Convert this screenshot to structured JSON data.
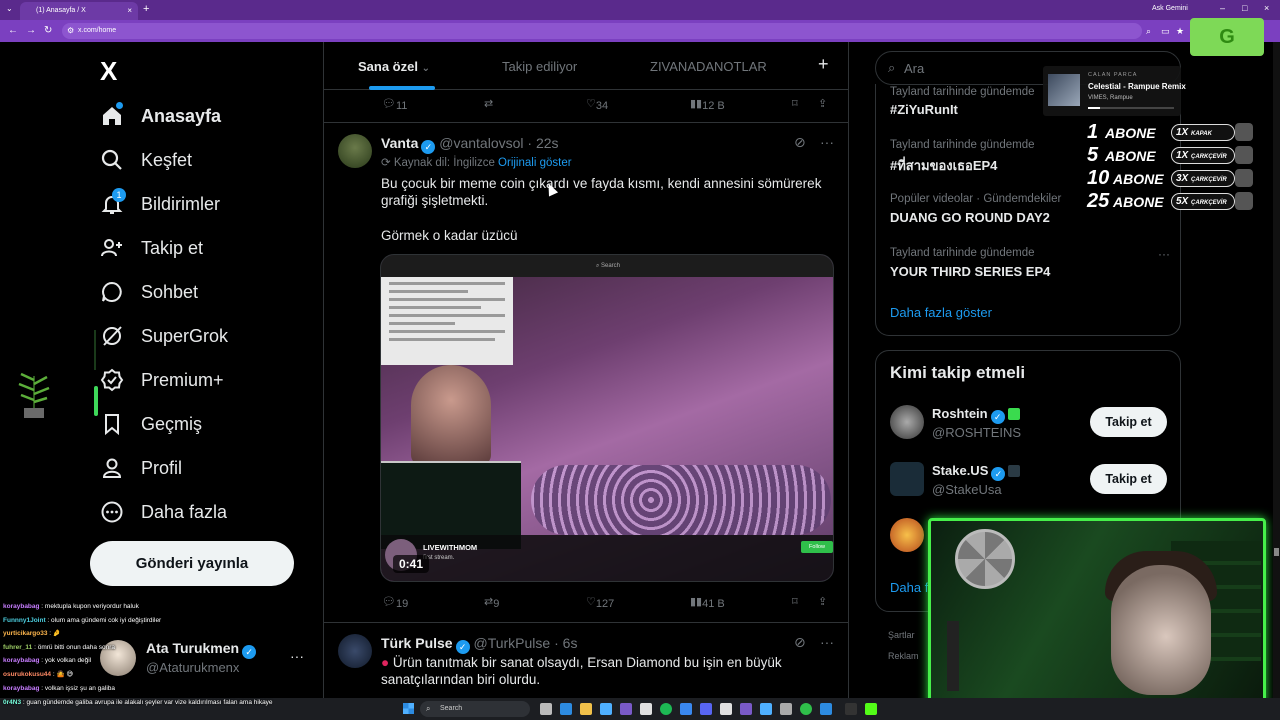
{
  "browser": {
    "tab_title": "(1) Anasayfa / X",
    "tab_close": "×",
    "new_tab": "+",
    "url": "x.com/home",
    "ask_gemini": "Ask Gemini",
    "window_buttons": [
      "–",
      "□",
      "×"
    ]
  },
  "overlay_badge": "G",
  "nav": {
    "logo": "X",
    "items": [
      {
        "label": "Anasayfa",
        "icon": "home-icon",
        "active": true
      },
      {
        "label": "Keşfet",
        "icon": "search-icon"
      },
      {
        "label": "Bildirimler",
        "icon": "bell-icon",
        "badge": "1"
      },
      {
        "label": "Takip et",
        "icon": "person-add-icon"
      },
      {
        "label": "Sohbet",
        "icon": "chat-icon"
      },
      {
        "label": "SuperGrok",
        "icon": "grok-icon"
      },
      {
        "label": "Premium+",
        "icon": "verified-icon"
      },
      {
        "label": "Geçmiş",
        "icon": "bookmark-icon"
      },
      {
        "label": "Profil",
        "icon": "profile-icon"
      },
      {
        "label": "Daha fazla",
        "icon": "more-circle-icon"
      }
    ],
    "post_button": "Gönderi yayınla",
    "account": {
      "name": "Ata Turukmen",
      "handle": "@Ataturukmenx",
      "more": "···"
    }
  },
  "feed": {
    "tabs": [
      "Sana özel",
      "Takip ediliyor",
      "ZIVANADANOTLAR"
    ],
    "active_tab": 0,
    "add_tab": "+",
    "prev_actions": {
      "replies": "11",
      "reposts": "",
      "likes": "34",
      "views": "12 B"
    },
    "tweets": [
      {
        "name": "Vanta",
        "handle": "@vantalovsol",
        "time": "22s",
        "translate_note": "Kaynak dil: İngilizce",
        "show_original": "Orijinali göster",
        "text_1": "Bu çocuk bir meme coin çıkardı ve fayda kısmı, kendi annesini sömürerek",
        "text_2": "grafiği şişletmekti.",
        "text_3": "Görmek o kadar üzücü",
        "media": {
          "search_label": "Search",
          "stream_name": "LIVEWITHMOM",
          "stream_sub": "first stream.",
          "follow": "Follow",
          "duration": "0:41"
        },
        "actions": {
          "replies": "19",
          "reposts": "9",
          "likes": "127",
          "views": "41 B"
        }
      },
      {
        "name": "Türk Pulse",
        "handle": "@TurkPulse",
        "time": "6s",
        "text_1": "Ürün tanıtmak bir sanat olsaydı, Ersan Diamond bu işin en büyük",
        "text_2": "sanatçılarından biri olurdu."
      }
    ]
  },
  "right": {
    "search_placeholder": "Ara",
    "trends": [
      {
        "meta": "Tayland tarihinde gündemde",
        "name": "#ZiYuRunIt"
      },
      {
        "meta": "Tayland tarihinde gündemde",
        "name": "#ที่สามของเธอEP4"
      },
      {
        "meta": "Popüler videolar · Gündemdekiler",
        "name": "DUANG GO ROUND DAY2"
      },
      {
        "meta": "Tayland tarihinde gündemde",
        "name": "YOUR THIRD SERIES EP4"
      }
    ],
    "show_more": "Daha fazla göster",
    "who_to_follow": {
      "title": "Kimi takip etmeli",
      "accounts": [
        {
          "name": "Roshtein",
          "handle": "@ROSHTEINS",
          "button": "Takip et"
        },
        {
          "name": "Stake.US",
          "handle": "@StakeUsa",
          "button": "Takip et"
        }
      ],
      "more": "Daha fazla göster"
    },
    "footer_1": "Şartlar",
    "footer_2": "Reklam"
  },
  "now_playing": {
    "label": "CALAN PARCA",
    "song": "Celestial - Rampue Remix",
    "artist": "VIMES, Rampue",
    "progress": 0.14
  },
  "sub_goals": [
    {
      "count": "1",
      "label": "ABONE",
      "reward": "1X",
      "reward_name": "KAPAK"
    },
    {
      "count": "5",
      "label": "ABONE",
      "reward": "1X",
      "reward_name": "ÇARKÇEVİR"
    },
    {
      "count": "10",
      "label": "ABONE",
      "reward": "3X",
      "reward_name": "ÇARKÇEVİR"
    },
    {
      "count": "25",
      "label": "ABONE",
      "reward": "5X",
      "reward_name": "ÇARKÇEVİR"
    }
  ],
  "chat": [
    {
      "user": "koraybabag",
      "color": "#c77dff",
      "msg": "mektupla kupon veriyordur haluk"
    },
    {
      "user": "Funnny1Joint",
      "color": "#4dd0e1",
      "msg": "olum ama gündemi cok iyi değiştirdiler"
    },
    {
      "user": "yurticikargo33",
      "color": "#ffb74d",
      "msg": "🤌"
    },
    {
      "user": "fuhrer_11",
      "color": "#9ccc65",
      "msg": "ömrü bitti onun daha sonra"
    },
    {
      "user": "koraybabag",
      "color": "#c77dff",
      "msg": "yok volkan değil"
    },
    {
      "user": "osurukokusu44",
      "color": "#ff8a65",
      "msg": "🤷 😅"
    },
    {
      "user": "koraybabag",
      "color": "#c77dff",
      "msg": "volkan işsiz şu an galiba"
    }
  ],
  "bottom_chat": {
    "user": "0r4N3",
    "msg": "guan gündemde galiba avrupa ile alakalı şeyler var vize kaldırılması falan ama hikaye"
  },
  "taskbar": {
    "search": "Search"
  },
  "colors": {
    "accent": "#1d9bf0",
    "browser": "#5a2a8c",
    "webcam_border": "#46f04a"
  }
}
